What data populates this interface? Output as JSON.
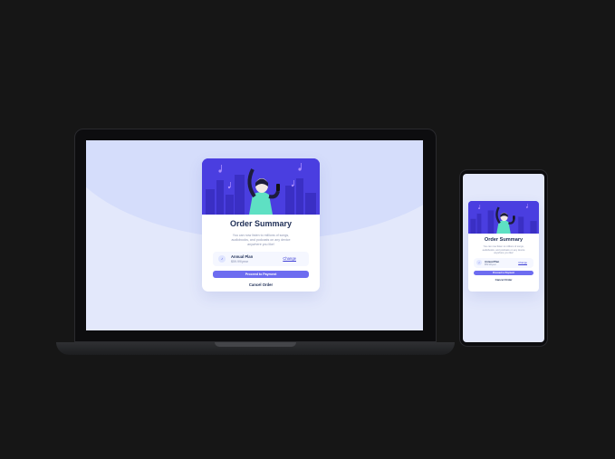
{
  "order_summary": {
    "title": "Order Summary",
    "description": "You can now listen to millions of songs, audiobooks, and podcasts on any device anywhere you like!",
    "plan": {
      "icon": "music-note-icon",
      "name": "Annual Plan",
      "price": "$59.99/year",
      "change_label": "Change"
    },
    "pay_label": "Proceed to Payment",
    "cancel_label": "Cancel Order"
  },
  "colors": {
    "page_background": "#161616",
    "screen_background": "#e3e8fb",
    "hero": "#4a3ee0",
    "primary": "#6d6cf0",
    "title": "#1f2f56",
    "muted": "#8a93b0"
  }
}
